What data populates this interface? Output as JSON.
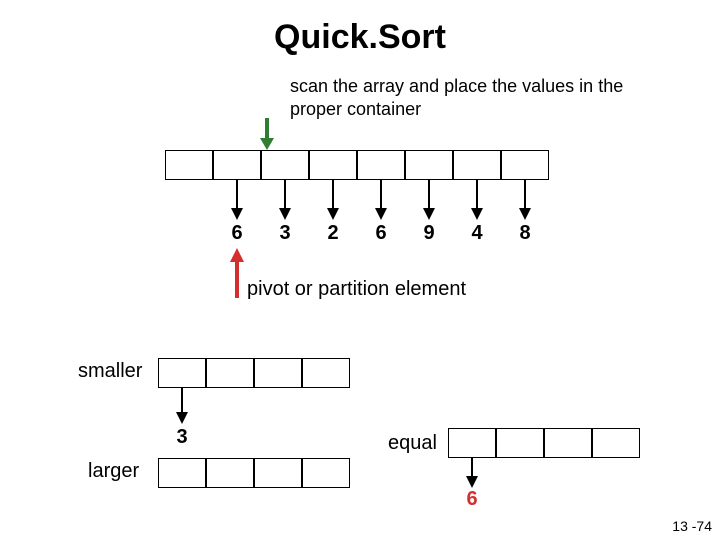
{
  "title": "Quick.Sort",
  "instruction": "scan the array and place the values in the proper container",
  "main_values": [
    "6",
    "3",
    "2",
    "6",
    "9",
    "4",
    "8"
  ],
  "pivot_label": "pivot or partition element",
  "smaller_label": "smaller",
  "larger_label": "larger",
  "equal_label": "equal",
  "smaller_values": [
    "3"
  ],
  "equal_values": [
    "6"
  ],
  "page_number": "13 -74",
  "chart_data": {
    "type": "diagram",
    "title": "Quick.Sort",
    "array": [
      6,
      3,
      2,
      6,
      9,
      4,
      8
    ],
    "pivot_index": 1,
    "pivot_value": 6,
    "partitions": {
      "smaller": {
        "capacity": 4,
        "values": [
          3
        ]
      },
      "larger": {
        "capacity": 4,
        "values": []
      },
      "equal": {
        "capacity": 4,
        "values": [
          6
        ]
      }
    },
    "annotations": [
      "scan the array and place the values in the proper container",
      "pivot or partition element"
    ]
  }
}
